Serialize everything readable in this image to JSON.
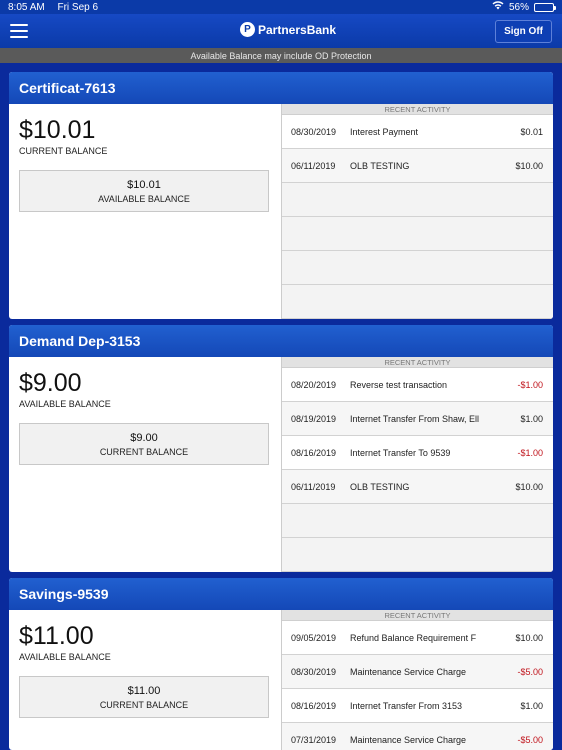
{
  "status": {
    "time": "8:05 AM",
    "date": "Fri Sep 6",
    "battery_percent": "56%",
    "battery_level": 0.56
  },
  "nav": {
    "brand": "PartnersBank",
    "signoff_label": "Sign Off"
  },
  "banner": "Available Balance may include OD Protection",
  "recent_activity_label": "RECENT ACTIVITY",
  "accounts": [
    {
      "name": "Certificat-7613",
      "main_amount": "$10.01",
      "main_label": "CURRENT BALANCE",
      "sub_amount": "$10.01",
      "sub_label": "AVAILABLE BALANCE",
      "transactions": [
        {
          "date": "08/30/2019",
          "desc": "Interest Payment",
          "amount": "$0.01",
          "negative": false
        },
        {
          "date": "06/11/2019",
          "desc": "OLB TESTING",
          "amount": "$10.00",
          "negative": false
        }
      ],
      "empty_rows": 4
    },
    {
      "name": "Demand Dep-3153",
      "main_amount": "$9.00",
      "main_label": "AVAILABLE BALANCE",
      "sub_amount": "$9.00",
      "sub_label": "CURRENT BALANCE",
      "transactions": [
        {
          "date": "08/20/2019",
          "desc": "Reverse test transaction",
          "amount": "-$1.00",
          "negative": true
        },
        {
          "date": "08/19/2019",
          "desc": "Internet Transfer From Shaw, Ell",
          "amount": "$1.00",
          "negative": false
        },
        {
          "date": "08/16/2019",
          "desc": "Internet Transfer To 9539",
          "amount": "-$1.00",
          "negative": true
        },
        {
          "date": "06/11/2019",
          "desc": "OLB TESTING",
          "amount": "$10.00",
          "negative": false
        }
      ],
      "empty_rows": 2
    },
    {
      "name": "Savings-9539",
      "main_amount": "$11.00",
      "main_label": "AVAILABLE BALANCE",
      "sub_amount": "$11.00",
      "sub_label": "CURRENT BALANCE",
      "transactions": [
        {
          "date": "09/05/2019",
          "desc": "Refund Balance Requirement F",
          "amount": "$10.00",
          "negative": false
        },
        {
          "date": "08/30/2019",
          "desc": "Maintenance Service Charge",
          "amount": "-$5.00",
          "negative": true
        },
        {
          "date": "08/16/2019",
          "desc": "Internet Transfer From 3153",
          "amount": "$1.00",
          "negative": false
        },
        {
          "date": "07/31/2019",
          "desc": "Maintenance Service Charge",
          "amount": "-$5.00",
          "negative": true
        }
      ],
      "empty_rows": 0
    }
  ],
  "colors": {
    "background": "#0a2a9c",
    "header": "#1448b7",
    "negative": "#c0141c"
  }
}
